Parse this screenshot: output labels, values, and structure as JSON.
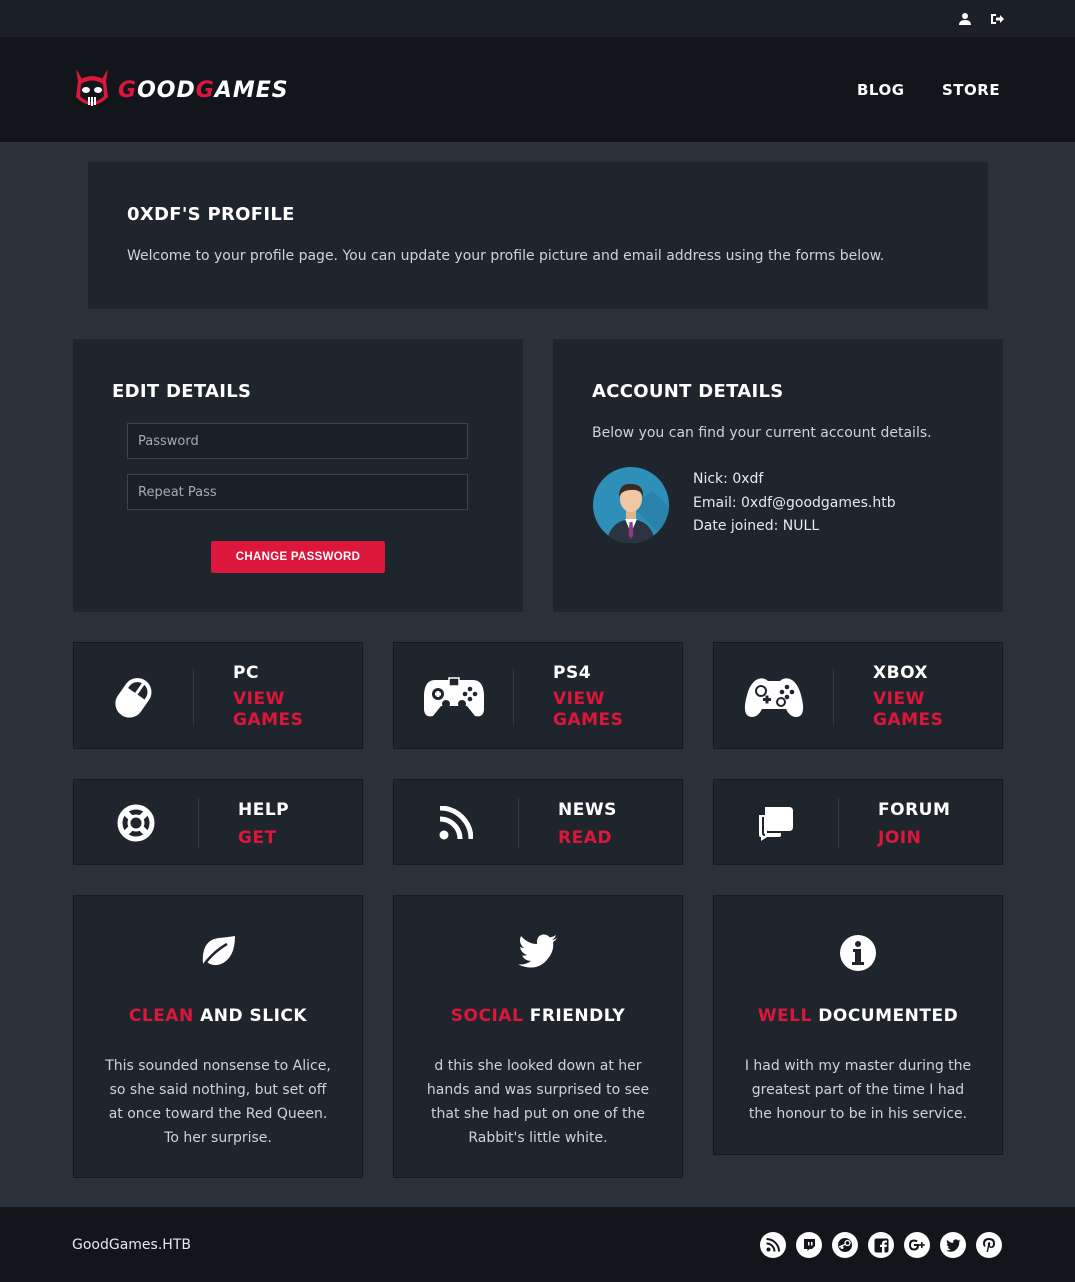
{
  "topbar": {
    "icons": [
      "user-icon",
      "sign-out-icon"
    ]
  },
  "brand": {
    "logo_part1": "G",
    "logo_part2": "OOD",
    "logo_part3": "G",
    "logo_part4": "AMES"
  },
  "nav": {
    "blog": "BLOG",
    "store": "STORE"
  },
  "profile": {
    "title": "0XDF'S PROFILE",
    "intro": "Welcome to your profile page. You can update your profile picture and email address using the forms below."
  },
  "edit": {
    "title": "EDIT DETAILS",
    "password_placeholder": "Password",
    "repeat_placeholder": "Repeat Pass",
    "button": "CHANGE PASSWORD"
  },
  "account": {
    "title": "ACCOUNT DETAILS",
    "intro": "Below you can find your current account details.",
    "nick": "Nick: 0xdf",
    "email": "Email: 0xdf@goodgames.htb",
    "joined": "Date joined: NULL"
  },
  "platforms": [
    {
      "title": "PC",
      "line1": "VIEW",
      "line2": "GAMES",
      "icon": "mouse-icon"
    },
    {
      "title": "PS4",
      "line1": "VIEW",
      "line2": "GAMES",
      "icon": "gamepad-icon"
    },
    {
      "title": "XBOX",
      "line1": "VIEW",
      "line2": "GAMES",
      "icon": "xbox-controller-icon"
    }
  ],
  "links": [
    {
      "title": "HELP",
      "action": "GET",
      "icon": "life-ring-icon"
    },
    {
      "title": "NEWS",
      "action": "READ",
      "icon": "rss-icon"
    },
    {
      "title": "FORUM",
      "action": "JOIN",
      "icon": "comments-icon"
    }
  ],
  "features": [
    {
      "accent": "CLEAN",
      "rest": " AND SLICK",
      "icon": "leaf-icon",
      "text": "This sounded nonsense to Alice, so she said nothing, but set off at once toward the Red Queen. To her surprise."
    },
    {
      "accent": "SOCIAL",
      "rest": " FRIENDLY",
      "icon": "twitter-icon",
      "text": "d this she looked down at her hands and was surprised to see that she had put on one of the Rabbit's little white."
    },
    {
      "accent": "WELL",
      "rest": " DOCUMENTED",
      "icon": "info-icon",
      "text": "I had with my master during the greatest part of the time I had the honour to be in his service."
    }
  ],
  "footer": {
    "copyright": "GoodGames.HTB",
    "social": [
      "rss-icon",
      "twitch-icon",
      "steam-icon",
      "facebook-icon",
      "google-plus-icon",
      "twitter-icon",
      "pinterest-icon"
    ]
  },
  "colors": {
    "accent": "#dd163b",
    "panel": "#1f252c",
    "background": "#2a3139",
    "navbar": "#12161b"
  }
}
